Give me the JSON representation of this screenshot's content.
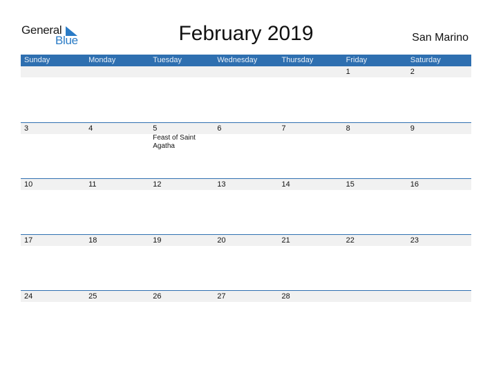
{
  "logo": {
    "part1": "General",
    "part2": "Blue",
    "icon": "flag-triangle-icon",
    "accent": "#2a7bc6"
  },
  "title": "February 2019",
  "country": "San Marino",
  "colors": {
    "header_bg": "#2e6fb0",
    "date_strip_bg": "#f1f1f1"
  },
  "weekdays": [
    "Sunday",
    "Monday",
    "Tuesday",
    "Wednesday",
    "Thursday",
    "Friday",
    "Saturday"
  ],
  "weeks": [
    {
      "days": [
        "",
        "",
        "",
        "",
        "",
        "1",
        "2"
      ],
      "events": [
        "",
        "",
        "",
        "",
        "",
        "",
        ""
      ]
    },
    {
      "days": [
        "3",
        "4",
        "5",
        "6",
        "7",
        "8",
        "9"
      ],
      "events": [
        "",
        "",
        "Feast of Saint Agatha",
        "",
        "",
        "",
        ""
      ]
    },
    {
      "days": [
        "10",
        "11",
        "12",
        "13",
        "14",
        "15",
        "16"
      ],
      "events": [
        "",
        "",
        "",
        "",
        "",
        "",
        ""
      ]
    },
    {
      "days": [
        "17",
        "18",
        "19",
        "20",
        "21",
        "22",
        "23"
      ],
      "events": [
        "",
        "",
        "",
        "",
        "",
        "",
        ""
      ]
    },
    {
      "days": [
        "24",
        "25",
        "26",
        "27",
        "28",
        "",
        ""
      ],
      "events": [
        "",
        "",
        "",
        "",
        "",
        "",
        ""
      ]
    }
  ]
}
